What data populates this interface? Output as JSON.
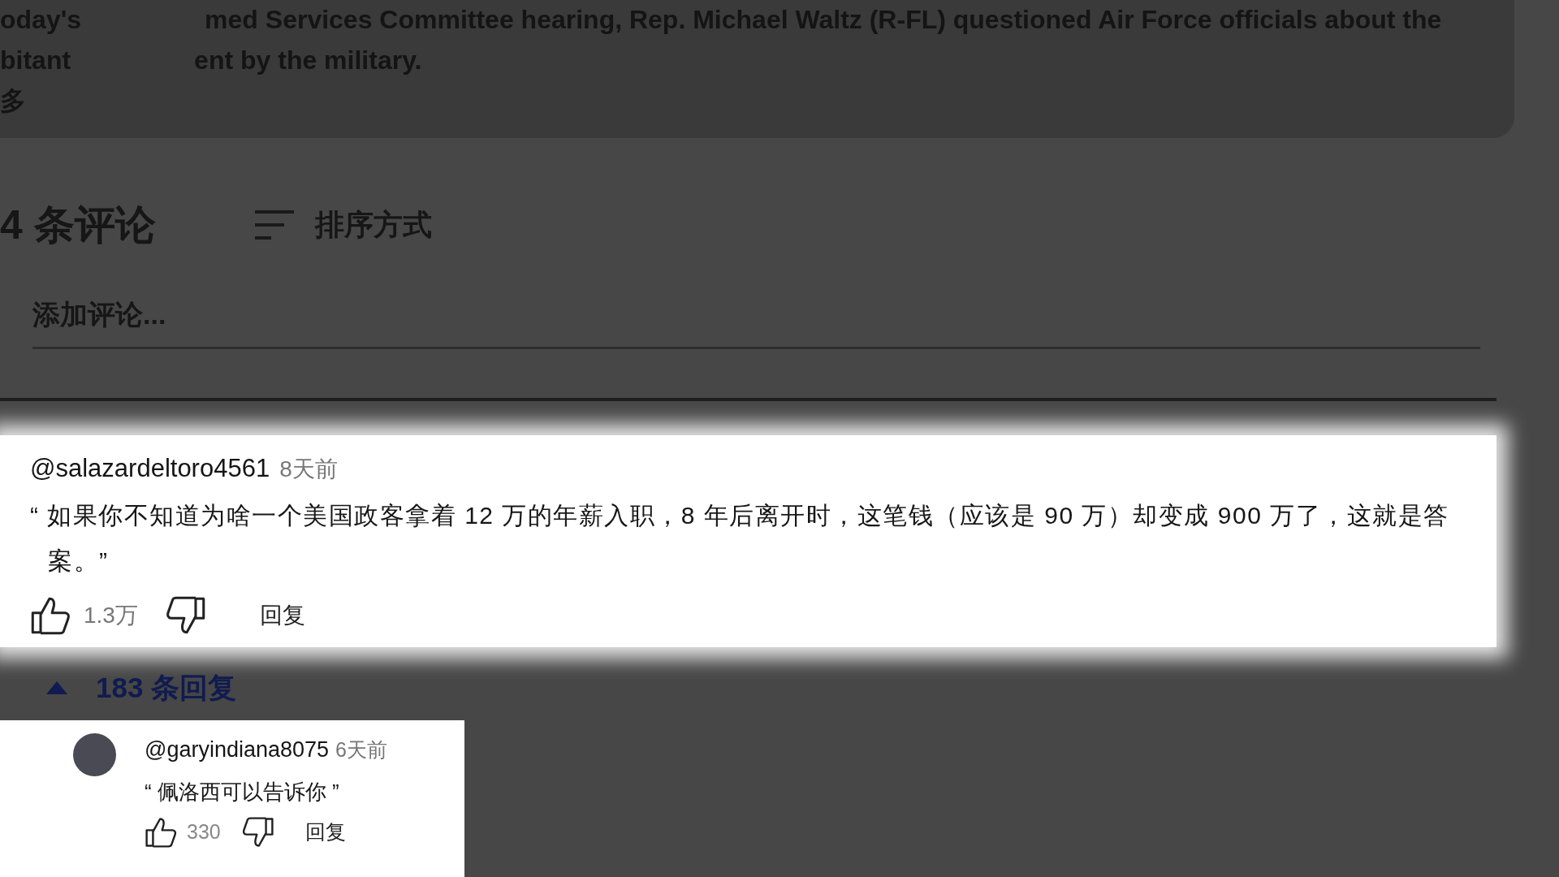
{
  "description": {
    "lines": [
      {
        "segments": [
          "oday's",
          "med Services Committee hearing, Rep. Michael Waltz (R-FL) questioned Air Force officials about the"
        ]
      },
      {
        "segments": [
          "bitant",
          "ent by the military."
        ]
      },
      {
        "segments": [
          "多"
        ]
      }
    ]
  },
  "comments_header": {
    "count": "4 条评论",
    "sort_label": "排序方式"
  },
  "add_comment": {
    "placeholder": "添加评论..."
  },
  "comment": {
    "author": "@salazardeltoro4561",
    "time": "8天前",
    "text": "“ 如果你不知道为啥一个美国政客拿着 12 万的年薪入职，8 年后离开时，这笔钱（应该是 90 万）却变成 900 万了，这就是答案。”",
    "likes": "1.3万",
    "reply": "回复"
  },
  "replies_toggle": {
    "label": "183 条回复",
    "expanded": true
  },
  "replies": [
    {
      "author": "@garyindiana8075",
      "time": "6天前",
      "text": "“ 佩洛西可以告诉你 ”",
      "likes": "330",
      "reply": "回复"
    }
  ]
}
